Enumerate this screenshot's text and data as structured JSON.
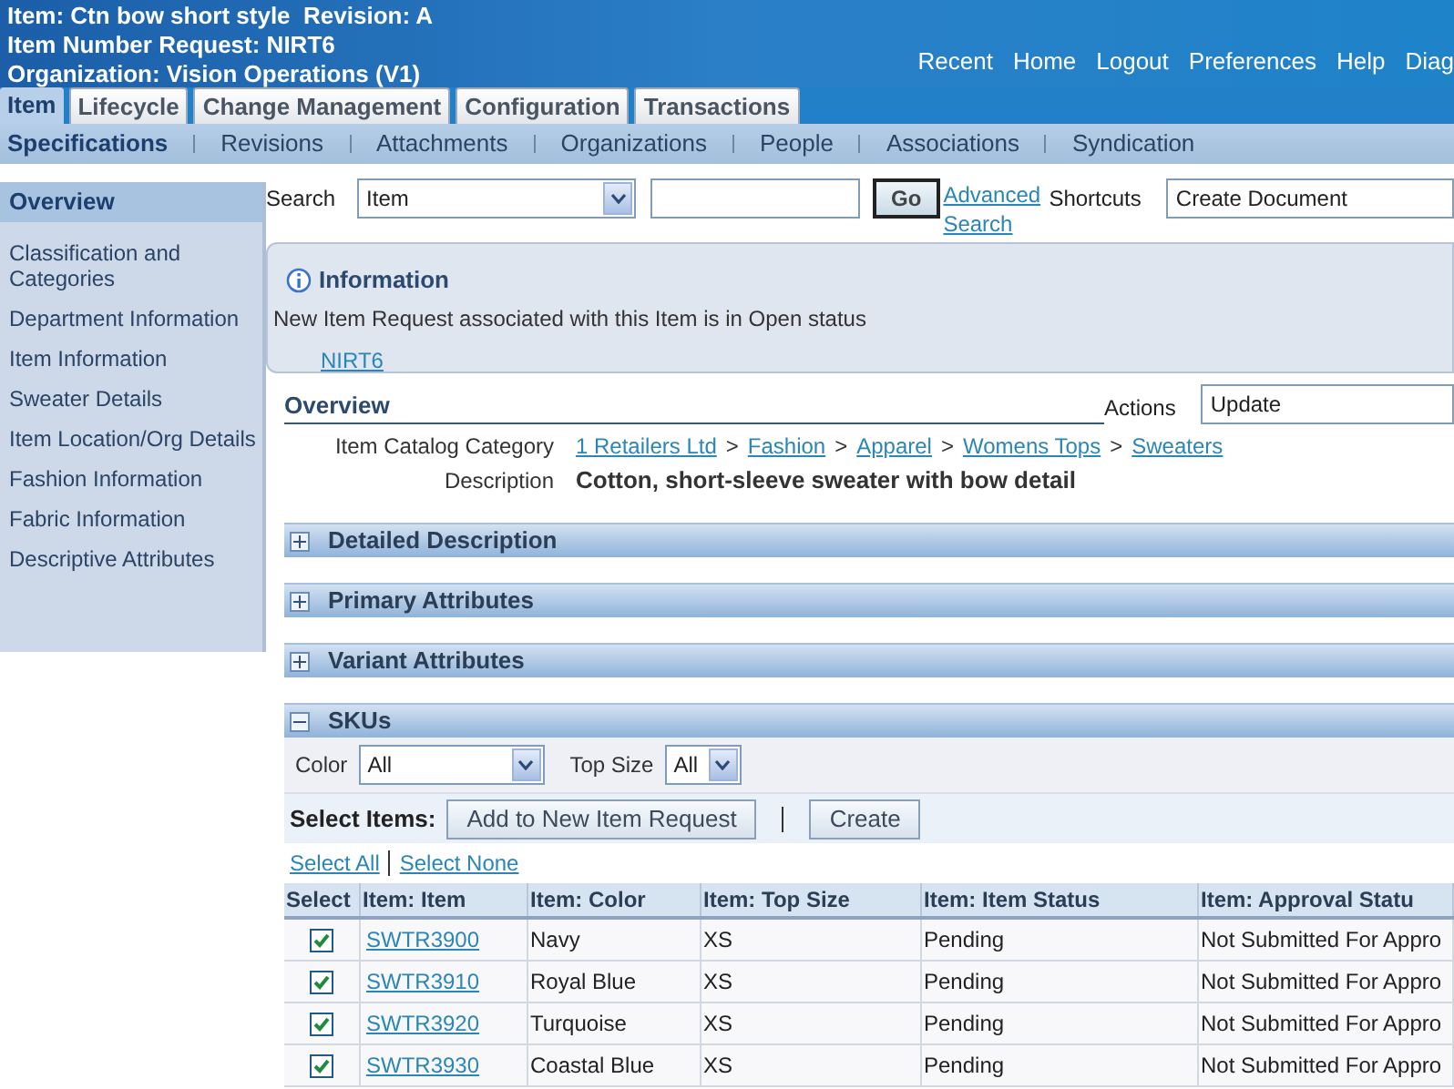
{
  "header": {
    "title_lines": [
      "Item: Ctn bow short style  Revision: A",
      "Item Number Request: NIRT6",
      "Organization: Vision Operations (V1)"
    ],
    "global_links": [
      "Recent",
      "Home",
      "Logout",
      "Preferences",
      "Help",
      "Diag"
    ]
  },
  "tabs": [
    {
      "label": "Item",
      "selected": true
    },
    {
      "label": "Lifecycle",
      "selected": false
    },
    {
      "label": "Change Management",
      "selected": false
    },
    {
      "label": "Configuration",
      "selected": false
    },
    {
      "label": "Transactions",
      "selected": false
    }
  ],
  "subtabs": [
    {
      "label": "Specifications",
      "selected": true
    },
    {
      "label": "Revisions",
      "selected": false
    },
    {
      "label": "Attachments",
      "selected": false
    },
    {
      "label": "Organizations",
      "selected": false
    },
    {
      "label": "People",
      "selected": false
    },
    {
      "label": "Associations",
      "selected": false
    },
    {
      "label": "Syndication",
      "selected": false
    }
  ],
  "sidebar": {
    "items": [
      {
        "label": "Overview",
        "selected": true
      },
      {
        "label": "Classification and Categories",
        "selected": false
      },
      {
        "label": "Department Information",
        "selected": false
      },
      {
        "label": "Item Information",
        "selected": false
      },
      {
        "label": "Sweater Details",
        "selected": false
      },
      {
        "label": "Item Location/Org Details",
        "selected": false
      },
      {
        "label": "Fashion Information",
        "selected": false
      },
      {
        "label": "Fabric Information",
        "selected": false
      },
      {
        "label": "Descriptive Attributes",
        "selected": false
      }
    ]
  },
  "search": {
    "label": "Search",
    "scope": "Item",
    "go": "Go",
    "advanced": "Advanced Search",
    "shortcuts_label": "Shortcuts",
    "shortcut": "Create Document"
  },
  "information": {
    "title": "Information",
    "message": "New Item Request associated with this Item is in Open status",
    "link": "NIRT6"
  },
  "overview": {
    "title": "Overview",
    "actions_label": "Actions",
    "action": "Update",
    "fields": [
      {
        "label": "Item Catalog Category",
        "kind": "links",
        "separator": ">",
        "links": [
          "1 Retailers Ltd",
          "Fashion",
          "Apparel",
          "Womens Tops",
          "Sweaters"
        ]
      },
      {
        "label": "Description",
        "kind": "text",
        "value": "Cotton, short-sleeve sweater with bow detail"
      }
    ]
  },
  "sections": [
    {
      "title": "Detailed Description",
      "expanded": false
    },
    {
      "title": "Primary Attributes",
      "expanded": false
    },
    {
      "title": "Variant Attributes",
      "expanded": false
    },
    {
      "title": "SKUs",
      "expanded": true,
      "content": {
        "filters": [
          {
            "label": "Color",
            "value": "All"
          },
          {
            "label": "Top Size",
            "value": "All"
          }
        ],
        "select_items_label": "Select Items:",
        "buttons": [
          "Add to New Item Request",
          "Create"
        ],
        "select_all": "Select All",
        "select_none": "Select None",
        "columns": [
          "Select",
          "Item: Item",
          "Item: Color",
          "Item: Top Size",
          "Item: Item Status",
          "Item: Approval Statu"
        ],
        "rows": [
          {
            "checked": true,
            "item": "SWTR3900",
            "color_name": "Navy",
            "size": "XS",
            "status": "Pending",
            "approval": "Not Submitted For Appro"
          },
          {
            "checked": true,
            "item": "SWTR3910",
            "color_name": "Royal Blue",
            "size": "XS",
            "status": "Pending",
            "approval": "Not Submitted For Appro"
          },
          {
            "checked": true,
            "item": "SWTR3920",
            "color_name": "Turquoise",
            "size": "XS",
            "status": "Pending",
            "approval": "Not Submitted For Appro"
          },
          {
            "checked": true,
            "item": "SWTR3930",
            "color_name": "Coastal Blue",
            "size": "XS",
            "status": "Pending",
            "approval": "Not Submitted For Appro"
          }
        ]
      }
    }
  ]
}
